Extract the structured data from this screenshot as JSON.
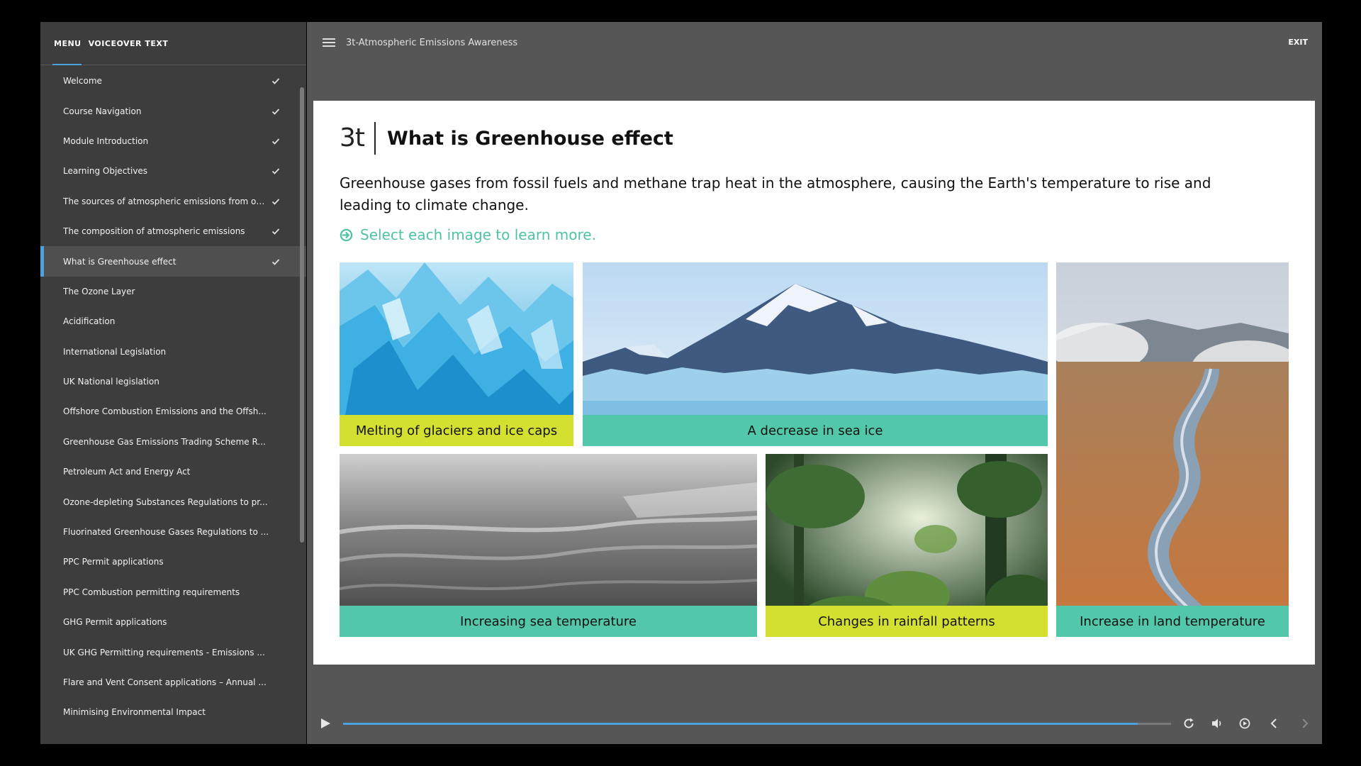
{
  "sidebar": {
    "tabs": [
      "MENU",
      "VOICEOVER TEXT"
    ],
    "items": [
      {
        "label": "Welcome",
        "completed": true
      },
      {
        "label": "Course Navigation",
        "completed": true
      },
      {
        "label": "Module Introduction",
        "completed": true
      },
      {
        "label": "Learning Objectives",
        "completed": true
      },
      {
        "label": "The sources of atmospheric emissions from op...",
        "completed": true
      },
      {
        "label": "The composition of atmospheric emissions",
        "completed": true
      },
      {
        "label": "What is Greenhouse effect",
        "completed": true,
        "active": true
      },
      {
        "label": "The Ozone Layer",
        "completed": false
      },
      {
        "label": "Acidification",
        "completed": false
      },
      {
        "label": "International Legislation",
        "completed": false
      },
      {
        "label": "UK National legislation",
        "completed": false
      },
      {
        "label": "Offshore Combustion Emissions and the Offsh...",
        "completed": false
      },
      {
        "label": "Greenhouse Gas Emissions Trading Scheme R...",
        "completed": false
      },
      {
        "label": "Petroleum Act and Energy Act",
        "completed": false
      },
      {
        "label": "Ozone-depleting Substances Regulations to pr...",
        "completed": false
      },
      {
        "label": "Fluorinated Greenhouse Gases Regulations to ...",
        "completed": false
      },
      {
        "label": "PPC Permit applications",
        "completed": false
      },
      {
        "label": "PPC Combustion permitting requirements",
        "completed": false
      },
      {
        "label": "GHG Permit applications",
        "completed": false
      },
      {
        "label": "UK GHG Permitting requirements - Emissions ...",
        "completed": false
      },
      {
        "label": "Flare and Vent Consent applications – Annual ...",
        "completed": false
      },
      {
        "label": "Minimising Environmental Impact",
        "completed": false
      }
    ]
  },
  "topbar": {
    "course_title": "3t-Atmospheric Emissions Awareness",
    "exit_label": "EXIT"
  },
  "slide": {
    "logo": "3t",
    "title": "What is Greenhouse effect",
    "body": "Greenhouse gases from fossil fuels and methane trap heat in the atmosphere, causing the Earth's temperature to rise and leading to climate change.",
    "instruction": "Select each image to learn more.",
    "tiles": [
      {
        "label": "Melting of glaciers and ice caps",
        "label_color": "yellow"
      },
      {
        "label": "A decrease in sea ice",
        "label_color": "green"
      },
      {
        "label": "Increase in land temperature",
        "label_color": "green"
      },
      {
        "label": "Increasing sea temperature",
        "label_color": "green"
      },
      {
        "label": "Changes in rainfall patterns",
        "label_color": "yellow"
      }
    ]
  },
  "player": {
    "progress": 0.96
  },
  "colors": {
    "accent_blue": "#4aa3df",
    "teal": "#52c7a9",
    "yellow": "#d3e02f"
  }
}
